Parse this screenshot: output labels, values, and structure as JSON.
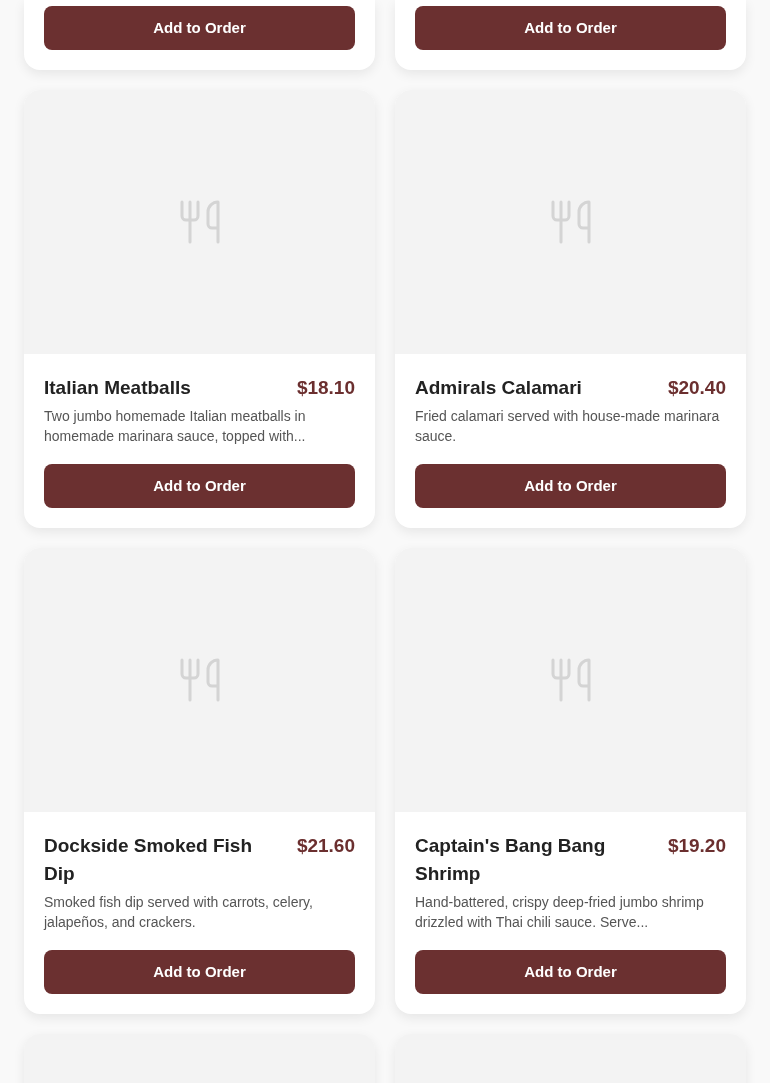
{
  "cards": [
    {
      "kind": "bottom_only",
      "button": "Add to Order"
    },
    {
      "kind": "bottom_only",
      "button": "Add to Order"
    },
    {
      "kind": "full",
      "name": "Italian Meatballs",
      "price": "$18.10",
      "description": "Two jumbo homemade Italian meatballs in homemade marinara sauce, topped with...",
      "button": "Add to Order"
    },
    {
      "kind": "full",
      "name": "Admirals Calamari",
      "price": "$20.40",
      "description": "Fried calamari served with house-made marinara sauce.",
      "button": "Add to Order"
    },
    {
      "kind": "full",
      "name": "Dockside Smoked Fish Dip",
      "price": "$21.60",
      "description": "Smoked fish dip served with carrots, celery, jalapeños, and crackers.",
      "button": "Add to Order"
    },
    {
      "kind": "full",
      "name": "Captain's Bang Bang Shrimp",
      "price": "$19.20",
      "description": "Hand-battered, crispy deep-fried jumbo shrimp drizzled with Thai chili sauce. Serve...",
      "button": "Add to Order"
    },
    {
      "kind": "top_only"
    },
    {
      "kind": "top_only"
    }
  ]
}
